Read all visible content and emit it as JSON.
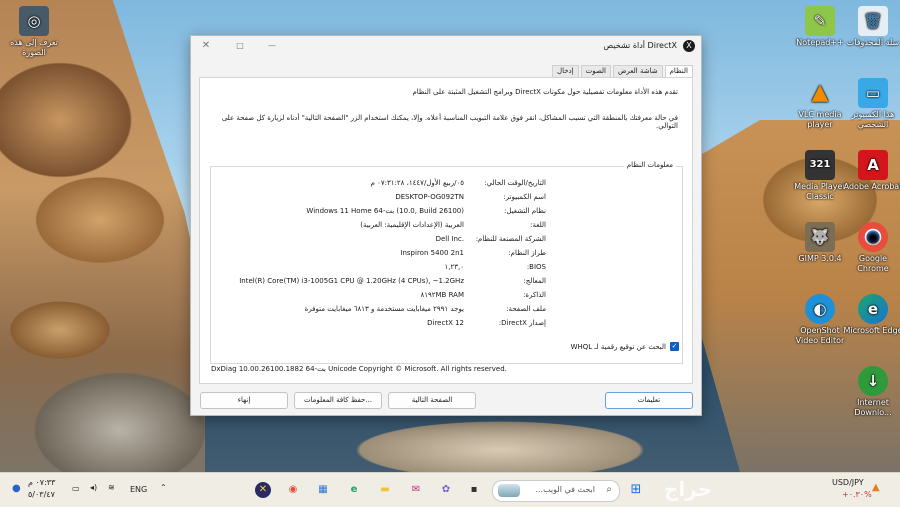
{
  "desktop": {
    "icons": [
      {
        "id": "notepadpp",
        "label": "Notepad++",
        "color": "#8ec64a",
        "glyph": "✎"
      },
      {
        "id": "recycle",
        "label": "سلة المحذوفات",
        "color": "#e6eef5",
        "glyph": "🗑"
      },
      {
        "id": "vlc",
        "label": "VLC media player",
        "color": "#f08b00",
        "glyph": "▲"
      },
      {
        "id": "thispc",
        "label": "هذا الكمبيوتر الشخصي",
        "color": "#39a8e6",
        "glyph": "▭"
      },
      {
        "id": "mediaplayer",
        "label": "Media Player Classic",
        "color": "#333333",
        "glyph": "321"
      },
      {
        "id": "acrobat",
        "label": "Adobe Acrobat",
        "color": "#d4161c",
        "glyph": "A"
      },
      {
        "id": "gimp",
        "label": "GIMP 3.0.4",
        "color": "#7c6d55",
        "glyph": "🐺"
      },
      {
        "id": "chrome",
        "label": "Google Chrome",
        "color": "#ffffff",
        "glyph": "◉"
      },
      {
        "id": "openshot",
        "label": "OpenShot Video Editor",
        "color": "#1e90d6",
        "glyph": "◐"
      },
      {
        "id": "edge",
        "label": "Microsoft Edge",
        "color": "#1ba56b",
        "glyph": "e"
      },
      {
        "id": "idm",
        "label": "Internet Downlo...",
        "color": "#2f9a3c",
        "glyph": "↓"
      },
      {
        "id": "topleft",
        "label": "تعرف إلى هذه الصورة",
        "color": "#475a68",
        "glyph": "◎"
      }
    ]
  },
  "window": {
    "title": "أداة تشخيص DirectX",
    "dx_icon": "X",
    "close_glyph": "✕",
    "max_glyph": "□",
    "min_glyph": "—",
    "tabs": [
      "النظام",
      "شاشة العرض",
      "الصوت",
      "إدخال"
    ],
    "intro": "تقدم هذه الأداة معلومات تفصيلية حول مكونات DirectX وبرامج التشغيل المثبتة على النظام",
    "help_text": "في حالة معرفتك بالمنطقة التي تسبب المشاكل، انقر فوق علامة التبويب المناسبة أعلاه. وإلا، يمكنك استخدام الزر \"الصفحة التالية\" أدناه لزيارة كل صفحة على التوالي.",
    "sysinfo_title": "معلومات النظام",
    "rows": [
      {
        "label": "التاريخ/الوقت الحالي:",
        "value": "٠٥/ربيع الأول/١٤٤٧، ٠٧:٣١:٢٨ م"
      },
      {
        "label": "اسم الكمبيوتر:",
        "value": "DESKTOP-OG092TN"
      },
      {
        "label": "نظام التشغيل:",
        "value": "Windows 11 Home 64-بت (10.0, Build 26100)"
      },
      {
        "label": "اللغة:",
        "value": "العربية (الإعدادات الإقليمية: العربية)"
      },
      {
        "label": "الشركة المصنعة للنظام:",
        "value": "Dell Inc."
      },
      {
        "label": "طراز النظام:",
        "value": "Inspiron 5400 2n1"
      },
      {
        "label": "BIOS:",
        "value": "١,٢٣,٠"
      },
      {
        "label": "المعالج:",
        "value": "Intel(R) Core(TM) i3-1005G1 CPU @ 1.20GHz (4 CPUs), ~1.2GHz"
      },
      {
        "label": "الذاكرة:",
        "value": "٨١٩٢MB RAM"
      },
      {
        "label": "ملف الصفحة:",
        "value": "يوجد ٢٩٩١ ميغابايت مستخدمة و ٦٨١٣ ميغابايت متوفرة"
      },
      {
        "label": "إصدار DirectX:",
        "value": "DirectX 12"
      }
    ],
    "whql_label": "البحث عن توقيع رقمية لـ WHQL",
    "copyright": "DxDiag 10.00.26100.1882 64-بت Unicode  Copyright © Microsoft. All rights reserved.",
    "buttons": {
      "help": "تعليمات",
      "next": "الصفحة التالية",
      "save": "حفظ كافة المعلومات...",
      "exit": "إنهاء"
    }
  },
  "taskbar": {
    "search_placeholder": "ابحث في الويب...",
    "search_glyph": "⌕",
    "apps": [
      {
        "id": "dxdiag",
        "glyph": "✕",
        "color": "#2b2b63"
      },
      {
        "id": "chrome",
        "glyph": "◉",
        "color": "#e74c3c"
      },
      {
        "id": "store",
        "glyph": "▦",
        "color": "#2f6fd6"
      },
      {
        "id": "edge",
        "glyph": "e",
        "color": "#1ba56b"
      },
      {
        "id": "explorer",
        "glyph": "▬",
        "color": "#f2c230"
      },
      {
        "id": "mail",
        "glyph": "✉",
        "color": "#c9317a"
      },
      {
        "id": "copilot",
        "glyph": "✿",
        "color": "#7b5cd6"
      },
      {
        "id": "terminal",
        "glyph": "▪",
        "color": "#333333"
      }
    ],
    "start_glyph": "⊞",
    "lang": "ENG",
    "time": "٠٧:٣٣ م",
    "date": "٥/٠٣/٤٧",
    "fx_pair": "USD/JPY",
    "fx_change": "+٠.٣٠%",
    "watermark": "حراج"
  }
}
